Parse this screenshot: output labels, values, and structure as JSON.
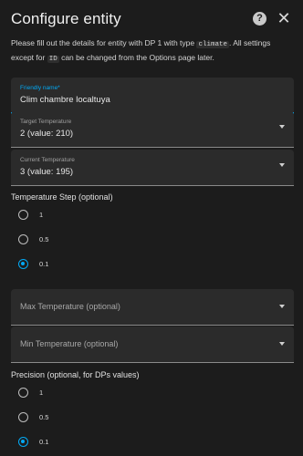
{
  "dialog": {
    "title": "Configure entity",
    "help_icon": "help-circle-icon",
    "close_icon": "close-icon",
    "description": {
      "part1": "Please fill out the details for entity with DP 1 with type ",
      "code1": "climate",
      "part2": ". All settings except for ",
      "code2": "ID",
      "part3": " can be changed from the Options page later."
    }
  },
  "fields": {
    "friendly_name": {
      "label": "Friendly name*",
      "value": "Clim chambre localtuya"
    },
    "target_temperature": {
      "label": "Target Temperature",
      "value": "2 (value: 210)"
    },
    "current_temperature": {
      "label": "Current Temperature",
      "value": "3 (value: 195)"
    },
    "max_temperature": {
      "placeholder": "Max Temperature (optional)"
    },
    "min_temperature": {
      "placeholder": "Min Temperature (optional)"
    }
  },
  "temperature_step": {
    "label": "Temperature Step (optional)",
    "options": [
      "1",
      "0.5",
      "0.1"
    ],
    "selected": "0.1"
  },
  "precision": {
    "label": "Precision (optional, for DPs values)",
    "options": [
      "1",
      "0.5",
      "0.1"
    ],
    "selected": "0.1"
  },
  "colors": {
    "accent": "#03a9f4",
    "background": "#1c1c1c",
    "field_background": "#2b2b2b"
  }
}
